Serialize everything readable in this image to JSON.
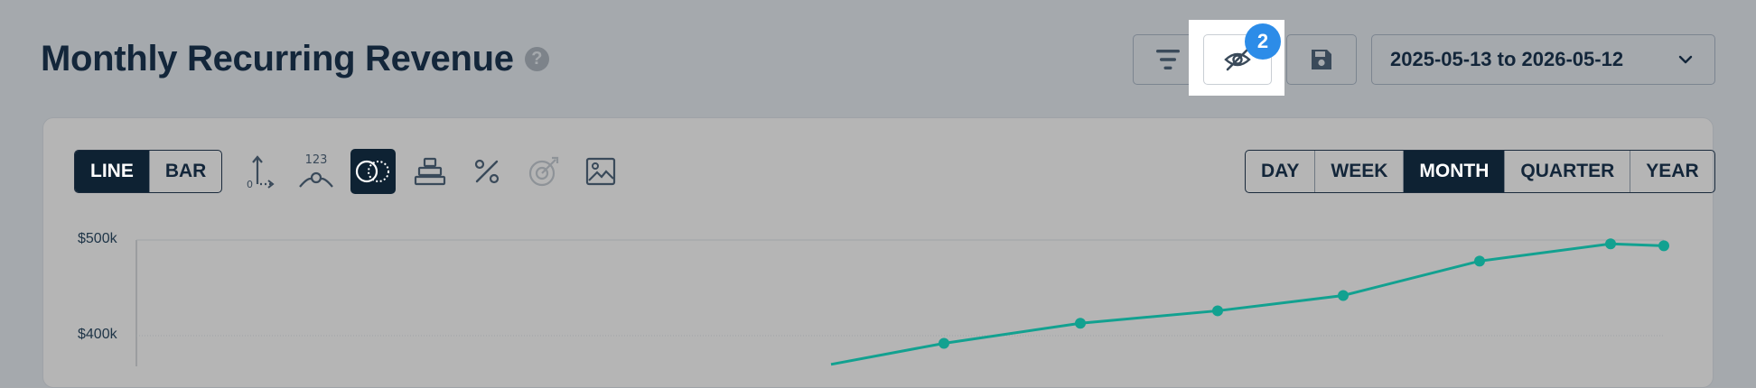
{
  "header": {
    "title": "Monthly Recurring Revenue",
    "help_glyph": "?",
    "hidden_count_badge": "2",
    "date_range": "2025-05-13 to 2026-05-12"
  },
  "chart_toolbar": {
    "chart_type_options": [
      "LINE",
      "BAR"
    ],
    "chart_type_selected": "LINE",
    "tools": [
      {
        "icon": "axis-origin-icon",
        "active": false
      },
      {
        "icon": "value-labels-icon",
        "label": "123",
        "active": false
      },
      {
        "icon": "compare-circles-icon",
        "active": true
      },
      {
        "icon": "stack-icon",
        "active": false
      },
      {
        "icon": "percent-icon",
        "active": false
      },
      {
        "icon": "goal-target-icon",
        "active": false,
        "disabled": true
      },
      {
        "icon": "image-export-icon",
        "active": false
      }
    ],
    "granularity_options": [
      "DAY",
      "WEEK",
      "MONTH",
      "QUARTER",
      "YEAR"
    ],
    "granularity_selected": "MONTH"
  },
  "colors": {
    "line": "#12a190",
    "active_bg": "#0e2233",
    "badge": "#2c8ce8"
  },
  "chart_data": {
    "type": "line",
    "y_tick_labels": [
      "$500k",
      "$400k"
    ],
    "ylim": [
      0,
      500000
    ],
    "series": [
      {
        "values": [
          370000,
          392000,
          413000,
          426000,
          442000,
          478000,
          496000,
          494000
        ]
      }
    ],
    "grid": true
  }
}
